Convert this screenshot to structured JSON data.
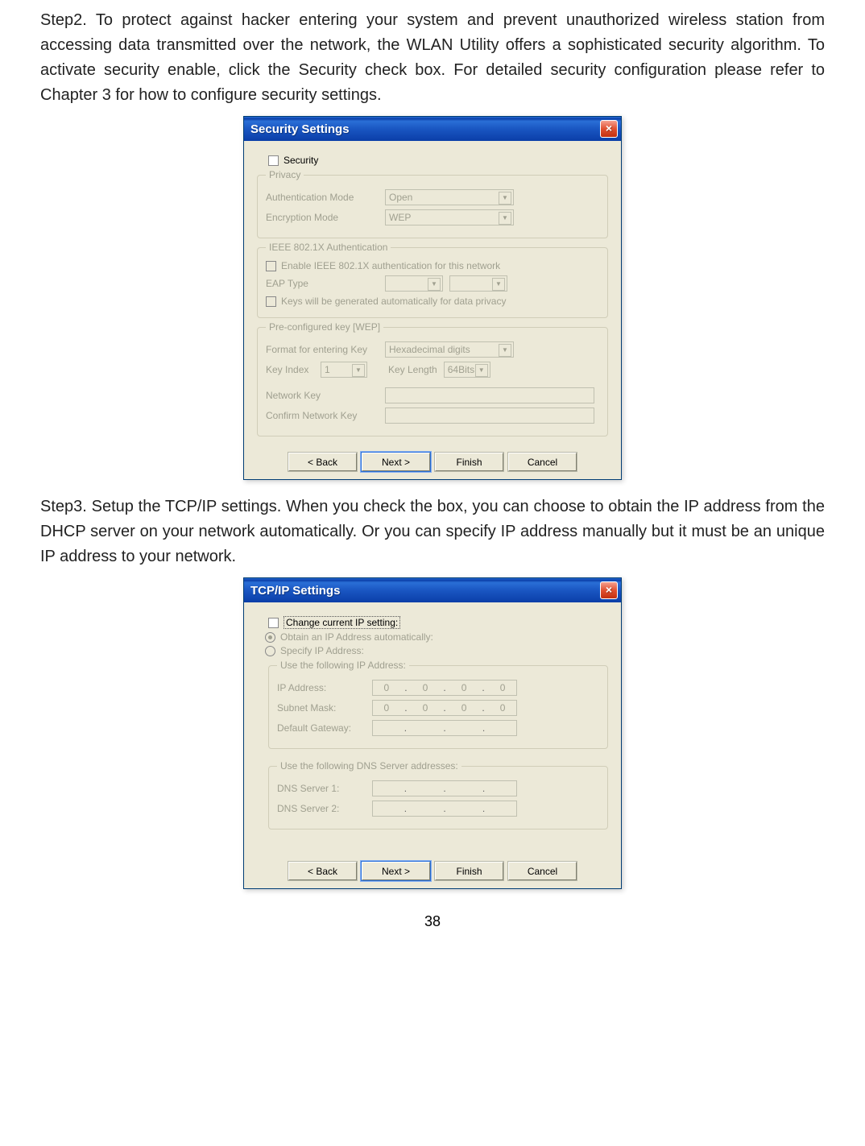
{
  "step2_text": "Step2. To protect against hacker entering your system and prevent unauthorized wireless station from accessing data transmitted over the network, the WLAN Utility offers a sophisticated security algorithm. To activate security enable, click the Security check box.  For detailed security configuration please refer to Chapter 3 for how to configure security settings.",
  "step3_text": "Step3. Setup the TCP/IP settings. When you check the box, you can choose to obtain the IP address from the DHCP server on your network automatically.  Or you can specify IP address manually but it must be an unique IP address to your network.",
  "page_number": "38",
  "dialog1": {
    "title": "Security Settings",
    "security_label": "Security",
    "privacy_legend": "Privacy",
    "auth_mode_label": "Authentication Mode",
    "auth_mode_value": "Open",
    "enc_mode_label": "Encryption Mode",
    "enc_mode_value": "WEP",
    "ieee_legend": "IEEE 802.1X Authentication",
    "enable_ieee_label": "Enable IEEE 802.1X authentication for this network",
    "eap_type_label": "EAP Type",
    "keys_auto_label": "Keys will be generated automatically for data privacy",
    "wep_legend": "Pre-configured key [WEP]",
    "format_label": "Format for entering Key",
    "format_value": "Hexadecimal digits",
    "key_index_label": "Key Index",
    "key_index_value": "1",
    "key_length_label": "Key Length",
    "key_length_value": "64Bits",
    "network_key_label": "Network Key",
    "confirm_key_label": "Confirm Network Key"
  },
  "dialog2": {
    "title": "TCP/IP Settings",
    "change_ip_label": "Change current IP setting:",
    "obtain_label": "Obtain an IP Address automatically:",
    "specify_label": "Specify IP Address:",
    "ip_legend": "Use the following IP Address:",
    "ip_addr_label": "IP Address:",
    "subnet_label": "Subnet Mask:",
    "gateway_label": "Default Gateway:",
    "dns_legend": "Use the following DNS Server addresses:",
    "dns1_label": "DNS Server 1:",
    "dns2_label": "DNS Server 2:",
    "ip_zero": "0"
  },
  "buttons": {
    "back": "< Back",
    "next": "Next >",
    "finish": "Finish",
    "cancel": "Cancel"
  }
}
